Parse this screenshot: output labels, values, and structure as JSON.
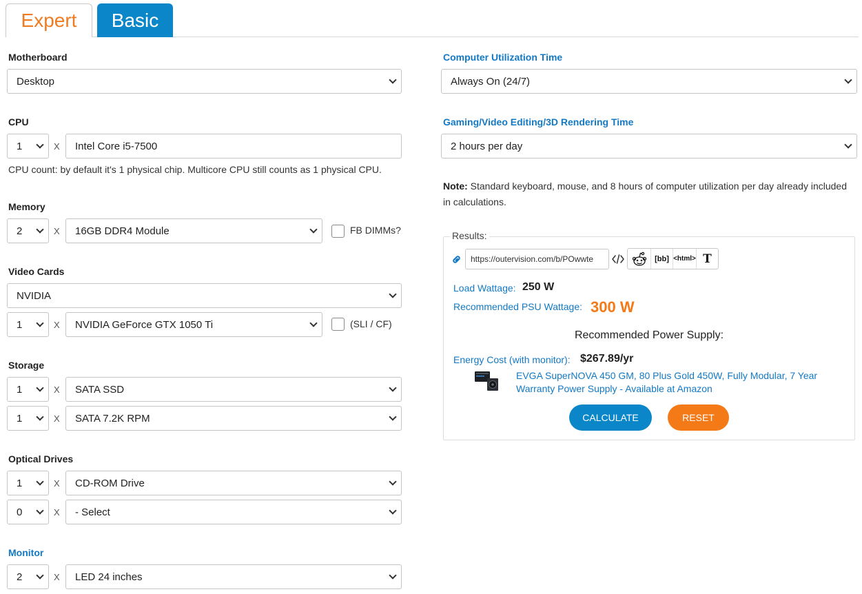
{
  "tabs": {
    "expert": "Expert",
    "basic": "Basic"
  },
  "left": {
    "motherboard": {
      "label": "Motherboard",
      "value": "Desktop"
    },
    "cpu": {
      "label": "CPU",
      "count": "1",
      "value": "Intel Core i5-7500",
      "help": "CPU count: by default it's 1 physical chip. Multicore CPU still counts as 1 physical CPU."
    },
    "memory": {
      "label": "Memory",
      "count": "2",
      "value": "16GB DDR4 Module",
      "checkbox_label": "FB DIMMs?"
    },
    "video": {
      "label": "Video Cards",
      "brand": "NVIDIA",
      "count": "1",
      "value": "NVIDIA GeForce GTX 1050 Ti",
      "checkbox_label": "(SLI / CF)"
    },
    "storage": {
      "label": "Storage",
      "rows": [
        {
          "count": "1",
          "value": "SATA SSD"
        },
        {
          "count": "1",
          "value": "SATA 7.2K RPM"
        }
      ]
    },
    "optical": {
      "label": "Optical Drives",
      "rows": [
        {
          "count": "1",
          "value": "CD-ROM Drive"
        },
        {
          "count": "0",
          "value": "- Select"
        }
      ]
    },
    "monitor": {
      "label": "Monitor",
      "count": "2",
      "value": "LED 24 inches"
    },
    "x": "X"
  },
  "right": {
    "utilization": {
      "label": "Computer Utilization Time",
      "value": "Always On (24/7)"
    },
    "gaming": {
      "label": "Gaming/Video Editing/3D Rendering Time",
      "value": "2 hours per day"
    },
    "note": {
      "bold": "Note:",
      "text": " Standard keyboard, mouse, and 8 hours of computer utilization per day already included in calculations."
    }
  },
  "results": {
    "legend": "Results:",
    "url": "https://outervision.com/b/POwwte",
    "share": {
      "bb": "[bb]",
      "html": "<html>",
      "t": "T"
    },
    "load_label": "Load Wattage:",
    "load_value": "250 W",
    "psu_label": "Recommended PSU Wattage:",
    "psu_value": "300 W",
    "psu_title": "Recommended Power Supply:",
    "energy_label": "Energy Cost (with monitor):",
    "energy_value": "$267.89/yr",
    "psu_product": "EVGA SuperNOVA 450 GM, 80 Plus Gold 450W, Fully Modular, 7 Year Warranty Power Supply - Available at Amazon",
    "calculate": "CALCULATE",
    "reset": "RESET"
  },
  "colors": {
    "accent_blue": "#0b87c9",
    "accent_orange": "#f47a17",
    "link_blue": "#1379c4"
  }
}
